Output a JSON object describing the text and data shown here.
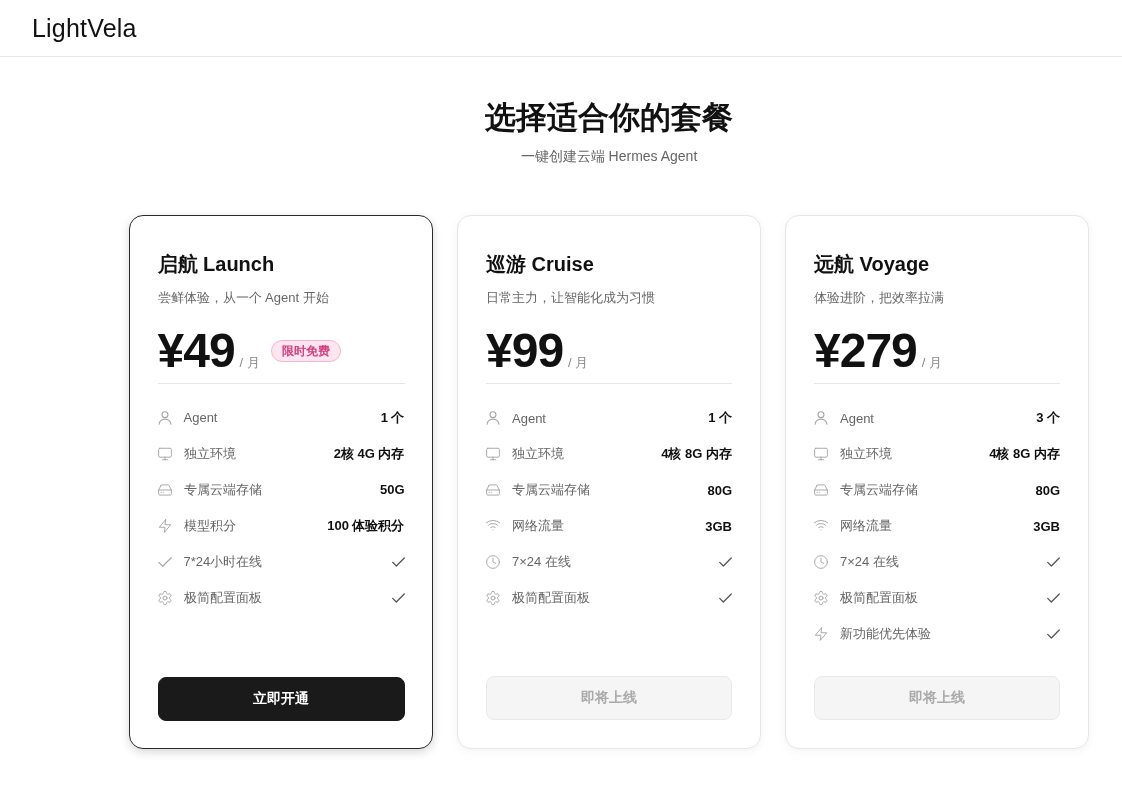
{
  "header": {
    "logo": "LightVela"
  },
  "hero": {
    "title": "选择适合你的套餐",
    "subtitle": "一键创建云端 Hermes Agent"
  },
  "plans": [
    {
      "name": "启航 Launch",
      "tagline": "尝鲜体验，从一个 Agent 开始",
      "price": "¥49",
      "period": "/ 月",
      "badge": "限时免费",
      "highlighted": true,
      "features": [
        {
          "kind": "agent",
          "label": "Agent",
          "value": "1 个"
        },
        {
          "kind": "environment",
          "label": "独立环境",
          "value": "2核 4G 内存"
        },
        {
          "kind": "storage",
          "label": "专属云端存储",
          "value": "50G"
        },
        {
          "kind": "credits",
          "label": "模型积分",
          "value": "100 体验积分"
        },
        {
          "kind": "online",
          "label": "7*24小时在线",
          "included": true
        },
        {
          "kind": "panel",
          "label": "极简配置面板",
          "included": true
        }
      ],
      "button": {
        "label": "立即开通",
        "disabled": false
      }
    },
    {
      "name": "巡游 Cruise",
      "tagline": "日常主力，让智能化成为习惯",
      "price": "¥99",
      "period": "/ 月",
      "highlighted": false,
      "features": [
        {
          "kind": "agent",
          "label": "Agent",
          "value": "1 个"
        },
        {
          "kind": "environment",
          "label": "独立环境",
          "value": "4核 8G 内存"
        },
        {
          "kind": "storage",
          "label": "专属云端存储",
          "value": "80G"
        },
        {
          "kind": "traffic",
          "label": "网络流量",
          "value": "3GB"
        },
        {
          "kind": "uptime",
          "label": "7×24 在线",
          "included": true
        },
        {
          "kind": "panel",
          "label": "极简配置面板",
          "included": true
        }
      ],
      "button": {
        "label": "即将上线",
        "disabled": true
      }
    },
    {
      "name": "远航 Voyage",
      "tagline": "体验进阶，把效率拉满",
      "price": "¥279",
      "period": "/ 月",
      "highlighted": false,
      "features": [
        {
          "kind": "agent",
          "label": "Agent",
          "value": "3 个"
        },
        {
          "kind": "environment",
          "label": "独立环境",
          "value": "4核 8G 内存"
        },
        {
          "kind": "storage",
          "label": "专属云端存储",
          "value": "80G"
        },
        {
          "kind": "traffic",
          "label": "网络流量",
          "value": "3GB"
        },
        {
          "kind": "uptime",
          "label": "7×24 在线",
          "included": true
        },
        {
          "kind": "panel",
          "label": "极简配置面板",
          "included": true
        },
        {
          "kind": "preview",
          "label": "新功能优先体验",
          "included": true
        }
      ],
      "button": {
        "label": "即将上线",
        "disabled": true
      }
    }
  ]
}
